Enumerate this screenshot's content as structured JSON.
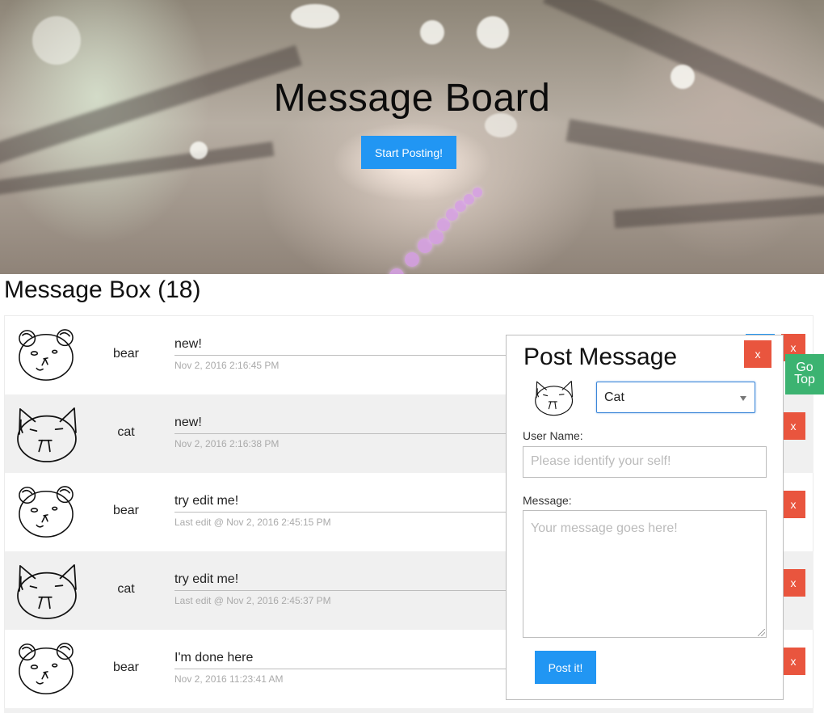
{
  "hero": {
    "title": "Message Board",
    "start_button": "Start Posting!"
  },
  "message_box": {
    "title": "Message Box (18)",
    "messages": [
      {
        "avatar": "bear",
        "user": "bear",
        "message": "new!",
        "timestamp": "Nov 2, 2016 2:16:45 PM",
        "delete_label": "x"
      },
      {
        "avatar": "cat",
        "user": "cat",
        "message": "new!",
        "timestamp": "Nov 2, 2016 2:16:38 PM",
        "delete_label": "x"
      },
      {
        "avatar": "bear",
        "user": "bear",
        "message": "try edit me!",
        "timestamp": "Last edit @ Nov 2, 2016 2:45:15 PM",
        "delete_label": "x"
      },
      {
        "avatar": "cat",
        "user": "cat",
        "message": "try edit me!",
        "timestamp": "Last edit @ Nov 2, 2016 2:45:37 PM",
        "delete_label": "x"
      },
      {
        "avatar": "bear",
        "user": "bear",
        "message": "I'm done here",
        "timestamp": "Nov 2, 2016 11:23:41 AM",
        "delete_label": "x"
      }
    ]
  },
  "post_modal": {
    "title": "Post Message",
    "close_label": "x",
    "avatar": "cat",
    "avatar_select_value": "Cat",
    "username_label": "User Name:",
    "username_placeholder": "Please identify your self!",
    "message_label": "Message:",
    "message_placeholder": "Your message goes here!",
    "submit_label": "Post it!"
  },
  "go_top": {
    "line1": "Go",
    "line2": "Top"
  },
  "colors": {
    "primary": "#2196f3",
    "danger": "#e9553e",
    "go_top": "#3cb371",
    "row_alt": "#f0f0f0"
  }
}
